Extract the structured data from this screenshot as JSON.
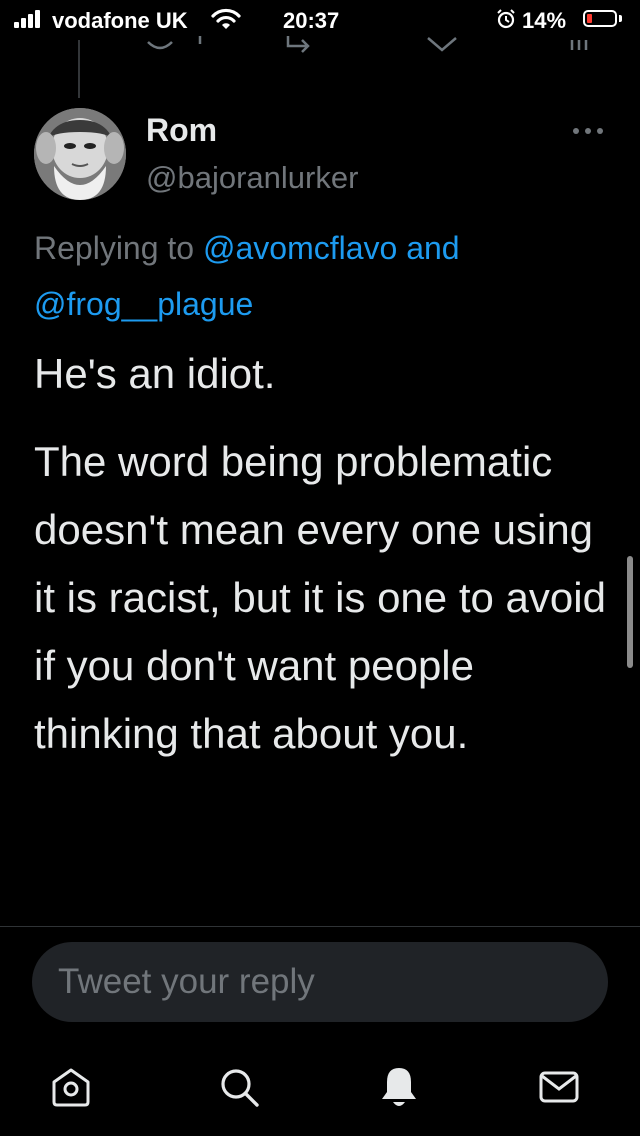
{
  "status_bar": {
    "carrier": "vodafone UK",
    "time": "20:37",
    "battery_percent": "14%",
    "battery_level": 0.14,
    "icons": [
      "signal-icon",
      "wifi-icon",
      "alarm-icon",
      "battery-icon"
    ]
  },
  "tweet": {
    "author_name": "Rom",
    "author_handle": "@bajoranlurker",
    "replying_prefix": "Replying to",
    "replying_user1": "@avomcflavo",
    "replying_joiner": "and",
    "replying_user2": "@frog__plague",
    "paragraph1": "He's an idiot.",
    "paragraph2": "The word being problematic doesn't mean every one using it is racist, but it is one to avoid if you don't want people thinking that about you."
  },
  "reply_box": {
    "placeholder": "Tweet your reply"
  },
  "tab_bar": {
    "items": [
      "home-icon",
      "search-icon",
      "notifications-icon",
      "messages-icon"
    ]
  },
  "colors": {
    "background": "#000000",
    "text": "#e7e9ea",
    "secondary": "#71767b",
    "link": "#1d9bf0",
    "battery_low": "#ff3b30"
  }
}
